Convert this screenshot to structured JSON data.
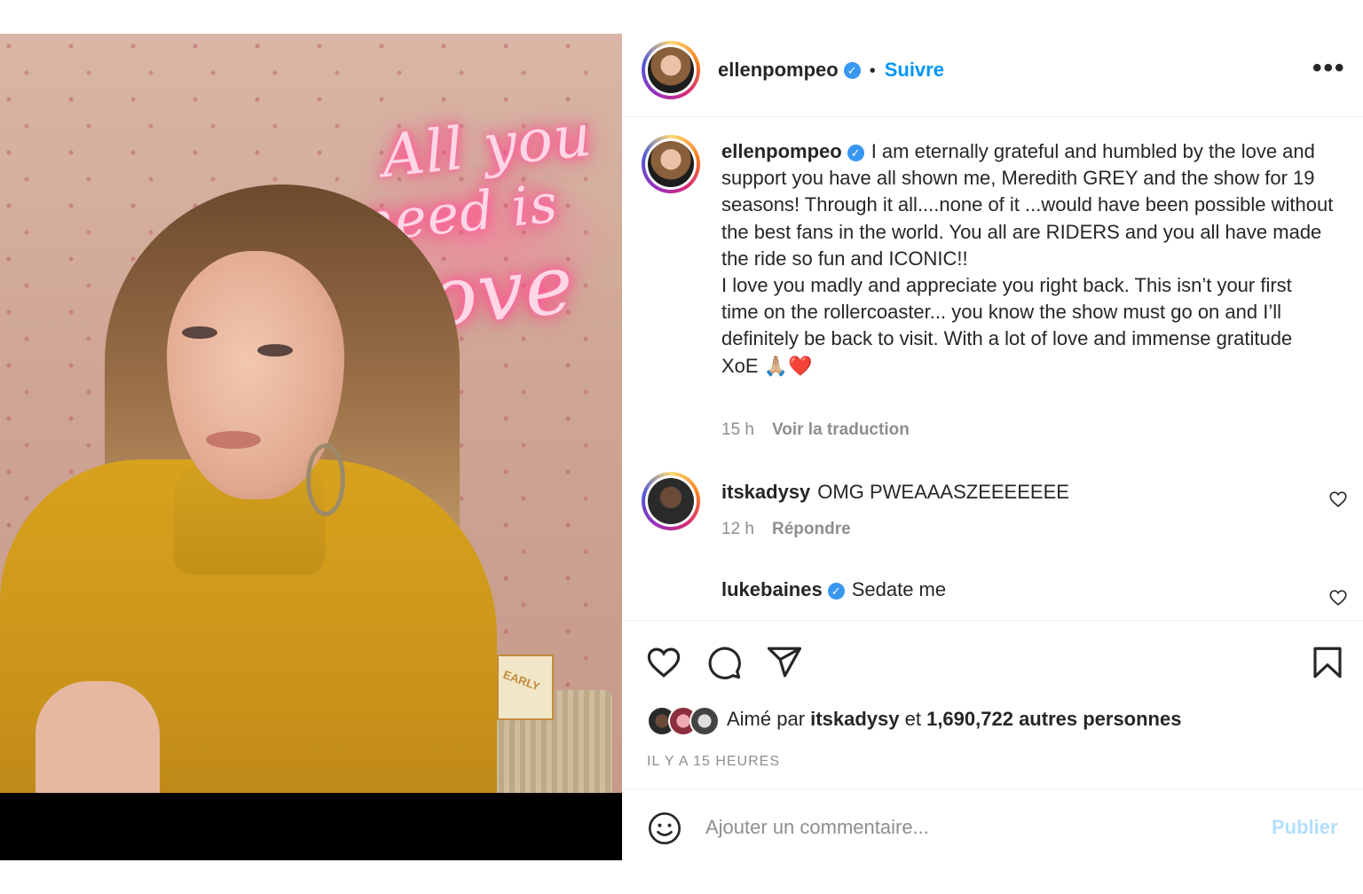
{
  "post": {
    "neon_sign": [
      "All you",
      "need is",
      "Love"
    ],
    "basket_label": "EARLY"
  },
  "header": {
    "username": "ellenpompeo",
    "separator": "•",
    "follow_label": "Suivre",
    "more_label": "•••"
  },
  "caption": {
    "username": "ellenpompeo",
    "text": "I am eternally grateful and humbled by the love and support you have all shown me, Meredith GREY and the show for 19 seasons! Through it all....none of it ...would have been possible without the best fans in the world. You all are RIDERS and you all have made the ride so fun and ICONIC!!\nI love you madly and appreciate you right back. This isn’t your first time on the rollercoaster... you know the show must go on and I’ll definitely be back to visit. With a lot of love and immense gratitude XoE 🙏🏼❤️",
    "age": "15 h",
    "translate_label": "Voir la traduction"
  },
  "comments": [
    {
      "username": "itskadysy",
      "text": "OMG PWEAAASZEEEEEEE",
      "age": "12 h",
      "reply_label": "Répondre"
    },
    {
      "username": "lukebaines",
      "text": "Sedate me"
    }
  ],
  "likes": {
    "prefix": "Aimé par",
    "user": "itskadysy",
    "connector": "et",
    "count_text": "1,690,722 autres personnes"
  },
  "timestamp": "IL Y A 15 HEURES",
  "add_comment": {
    "placeholder": "Ajouter un commentaire...",
    "publish_label": "Publier"
  },
  "colors": {
    "accent_link": "#0095f6",
    "verified": "#3897f0",
    "publish_disabled": "#b2dffc",
    "muted_text": "#8e8e8e"
  }
}
